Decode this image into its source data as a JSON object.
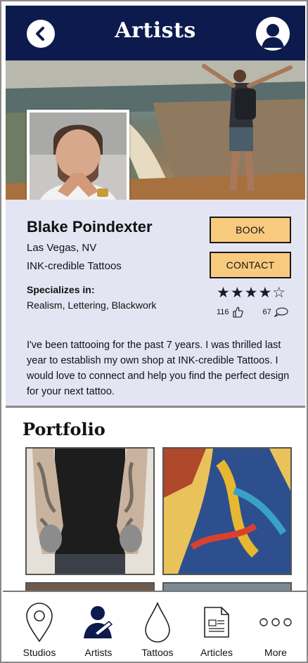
{
  "header": {
    "title": "Artists"
  },
  "artist": {
    "name": "Blake Poindexter",
    "location": "Las Vegas, NV",
    "shop": "INK-credible Tattoos",
    "specializes_label": "Specializes in:",
    "specialties": "Realism, Lettering, Blackwork",
    "rating": 4,
    "rating_max": 5,
    "rating_stars": "★★★★☆",
    "likes": "116",
    "comments": "67",
    "bio": "I've been tattooing for the past 7 years. I was thrilled last year to establish my own shop at INK-credible Tattoos. I would love to connect and help you find the perfect design for your next tattoo."
  },
  "actions": {
    "book": "BOOK",
    "contact": "CONTACT"
  },
  "portfolio": {
    "title": "Portfolio"
  },
  "nav": {
    "studios": "Studios",
    "artists": "Artists",
    "tattoos": "Tattoos",
    "articles": "Articles",
    "more": "More"
  },
  "colors": {
    "header_bg": "#0d1a4e",
    "panel_bg": "#e4e5f3",
    "button_bg": "#f7ca7e"
  },
  "icons": {
    "back": "chevron-left-icon",
    "profile": "user-icon",
    "studios": "map-pin-icon",
    "artists": "artist-icon",
    "tattoos": "ink-drop-icon",
    "articles": "article-icon",
    "more": "more-dots-icon",
    "likes": "thumbs-up-icon",
    "comments": "comment-icon"
  }
}
